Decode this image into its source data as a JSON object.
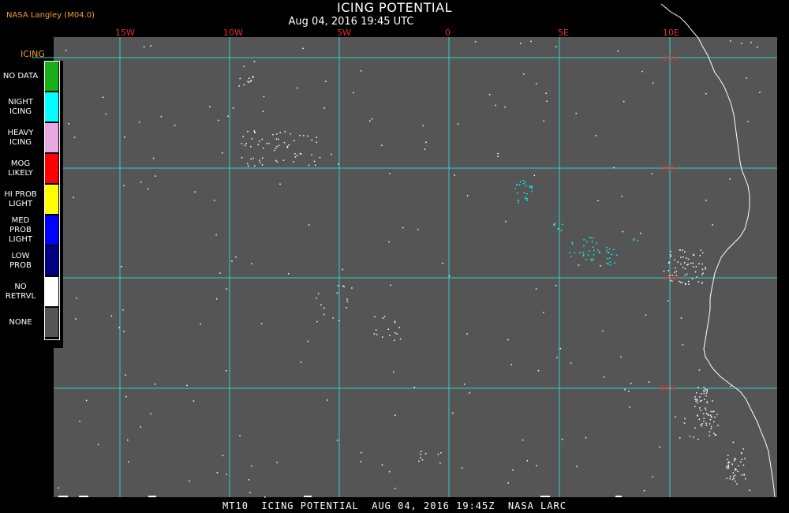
{
  "header": {
    "credit": "NASA Langley (M04.0)",
    "title": "ICING POTENTIAL",
    "subtitle": "Aug 04, 2016 19:45 UTC"
  },
  "footer": {
    "text": "MT10  ICING POTENTIAL  AUG 04, 2016 19:45Z  NASA LARC"
  },
  "legend": {
    "title": "ICING",
    "items": [
      {
        "label": "NO DATA",
        "color": "#18b018"
      },
      {
        "label": "NIGHT\nICING",
        "color": "#00ffff"
      },
      {
        "label": "HEAVY\nICING",
        "color": "#e8a8e0"
      },
      {
        "label": "MOG\nLIKELY",
        "color": "#ff0000"
      },
      {
        "label": "HI PROB\nLIGHT",
        "color": "#ffff00"
      },
      {
        "label": "MED PROB\nLIGHT",
        "color": "#0000ff"
      },
      {
        "label": "LOW\nPROB",
        "color": "#000080"
      },
      {
        "label": "NO\nRETRVL",
        "color": "#ffffff"
      },
      {
        "label": "NONE",
        "color": "#555555"
      }
    ]
  },
  "map": {
    "background_color": "#555555",
    "grid_color": "#30d0d0",
    "coast_color": "#ffffff",
    "longitude_labels": [
      "15W",
      "10W",
      "5W",
      "0",
      "5E",
      "10E"
    ],
    "latitude_labels": [
      "15S",
      "20S",
      "25S",
      "30S"
    ]
  }
}
